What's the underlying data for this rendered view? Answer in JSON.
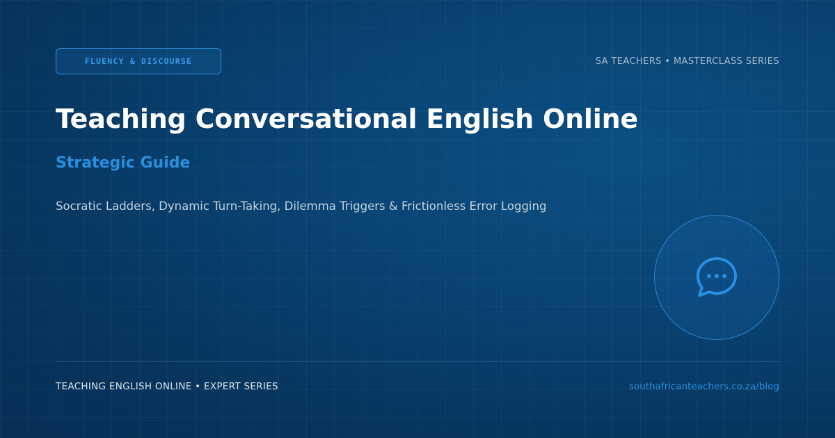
{
  "badge": {
    "label": "FLUENCY & DISCOURSE"
  },
  "header": {
    "series": "SA TEACHERS • MASTERCLASS SERIES"
  },
  "main": {
    "title": "Teaching Conversational English Online",
    "subtitle": "Strategic Guide",
    "description": "Socratic Ladders, Dynamic Turn-Taking, Dilemma Triggers & Frictionless Error Logging"
  },
  "icon": {
    "name": "chat-bubble-icon",
    "color": "#2a8fdf"
  },
  "footer": {
    "series": "TEACHING ENGLISH ONLINE • EXPERT SERIES",
    "url": "southafricanteachers.co.za/blog"
  },
  "colors": {
    "background": "#07365f",
    "accent": "#2a8fdf",
    "title": "#ffffff",
    "muted": "#a9bccd"
  }
}
